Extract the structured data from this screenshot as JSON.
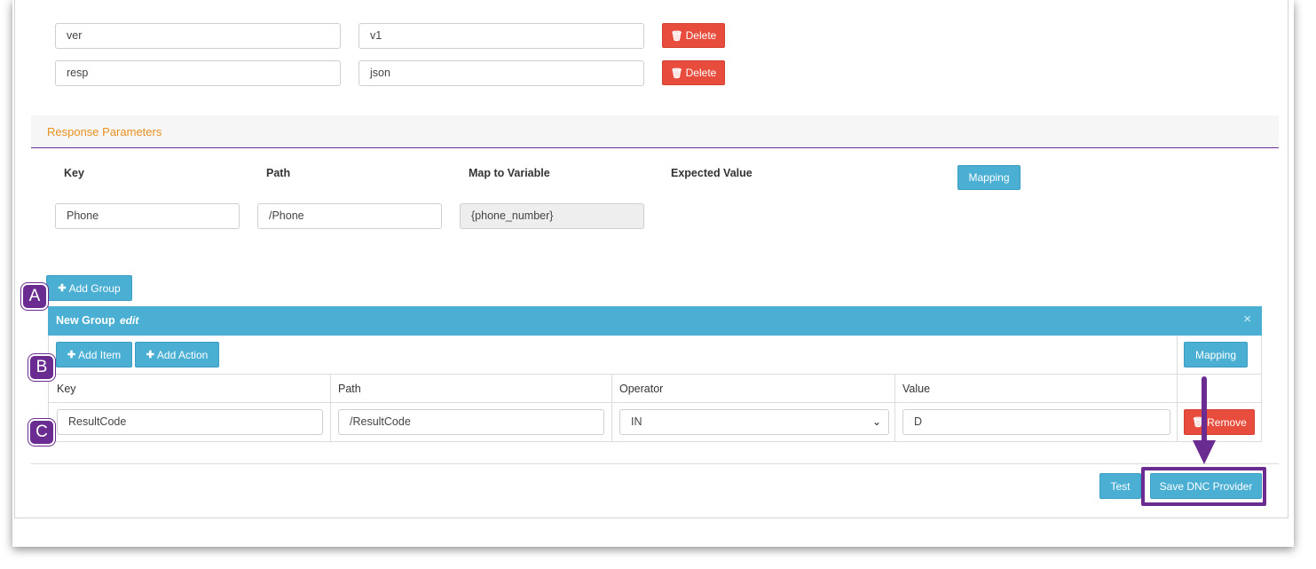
{
  "request_params": [
    {
      "key": "ver",
      "value": "v1",
      "delete_label": "Delete"
    },
    {
      "key": "resp",
      "value": "json",
      "delete_label": "Delete"
    }
  ],
  "response_section": {
    "title": "Response Parameters",
    "columns": {
      "key": "Key",
      "path": "Path",
      "map": "Map to Variable",
      "expected": "Expected Value"
    },
    "mapping_label": "Mapping",
    "row": {
      "key": "Phone",
      "path": "/Phone",
      "map": "{phone_number}"
    }
  },
  "add_group_label": "Add Group",
  "group": {
    "title": "New Group",
    "edit_label": "edit",
    "close_glyph": "×",
    "add_item_label": "Add Item",
    "add_action_label": "Add Action",
    "mapping_label": "Mapping",
    "columns": {
      "key": "Key",
      "path": "Path",
      "operator": "Operator",
      "value": "Value"
    },
    "row": {
      "key": "ResultCode",
      "path": "/ResultCode",
      "operator": "IN",
      "value": "D",
      "remove_label": "Remove"
    }
  },
  "footer": {
    "test_label": "Test",
    "save_label": "Save DNC Provider"
  },
  "annotations": {
    "a": "A",
    "b": "B",
    "c": "C"
  },
  "icons": {
    "delete": "trash-icon",
    "add": "plus-icon",
    "select": "chevron-down-icon"
  },
  "colors": {
    "accent": "#4aafd3",
    "danger": "#e74c3c",
    "annotation": "#6a2c91",
    "section_title": "#e8901f"
  }
}
